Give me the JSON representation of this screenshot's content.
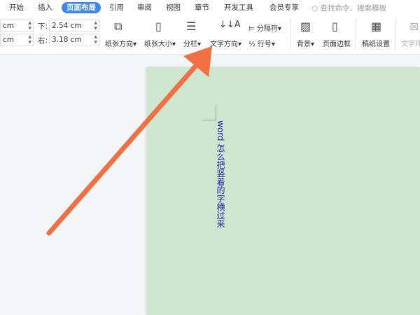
{
  "tabs": [
    "开始",
    "插入",
    "页面布局",
    "引用",
    "审阅",
    "视图",
    "章节",
    "开发工具",
    "会员专享"
  ],
  "active_tab": "页面布局",
  "search_placeholder": "查找命令、搜索模板",
  "margins": {
    "top_left_value": "cm",
    "bottom_left_value": "cm",
    "bottom_label": "下:",
    "bottom_value": "2.54 cm",
    "right_label": "右:",
    "right_value": "3.18 cm"
  },
  "ribbon": {
    "orientation": "纸张方向",
    "size": "纸张大小",
    "columns": "分栏",
    "text_direction": "文字方向",
    "separator": "分隔符",
    "line_numbers": "行号",
    "background": "背景",
    "page_border": "页面边框",
    "manuscript": "稿纸设置",
    "text_wrap": "文字环"
  },
  "document": {
    "text": "word 怎么把竖着的字横过来"
  },
  "colors": {
    "accent": "#3d86f0",
    "page": "#cde6cd",
    "arrow": "#f07043",
    "text": "#2222bb"
  }
}
